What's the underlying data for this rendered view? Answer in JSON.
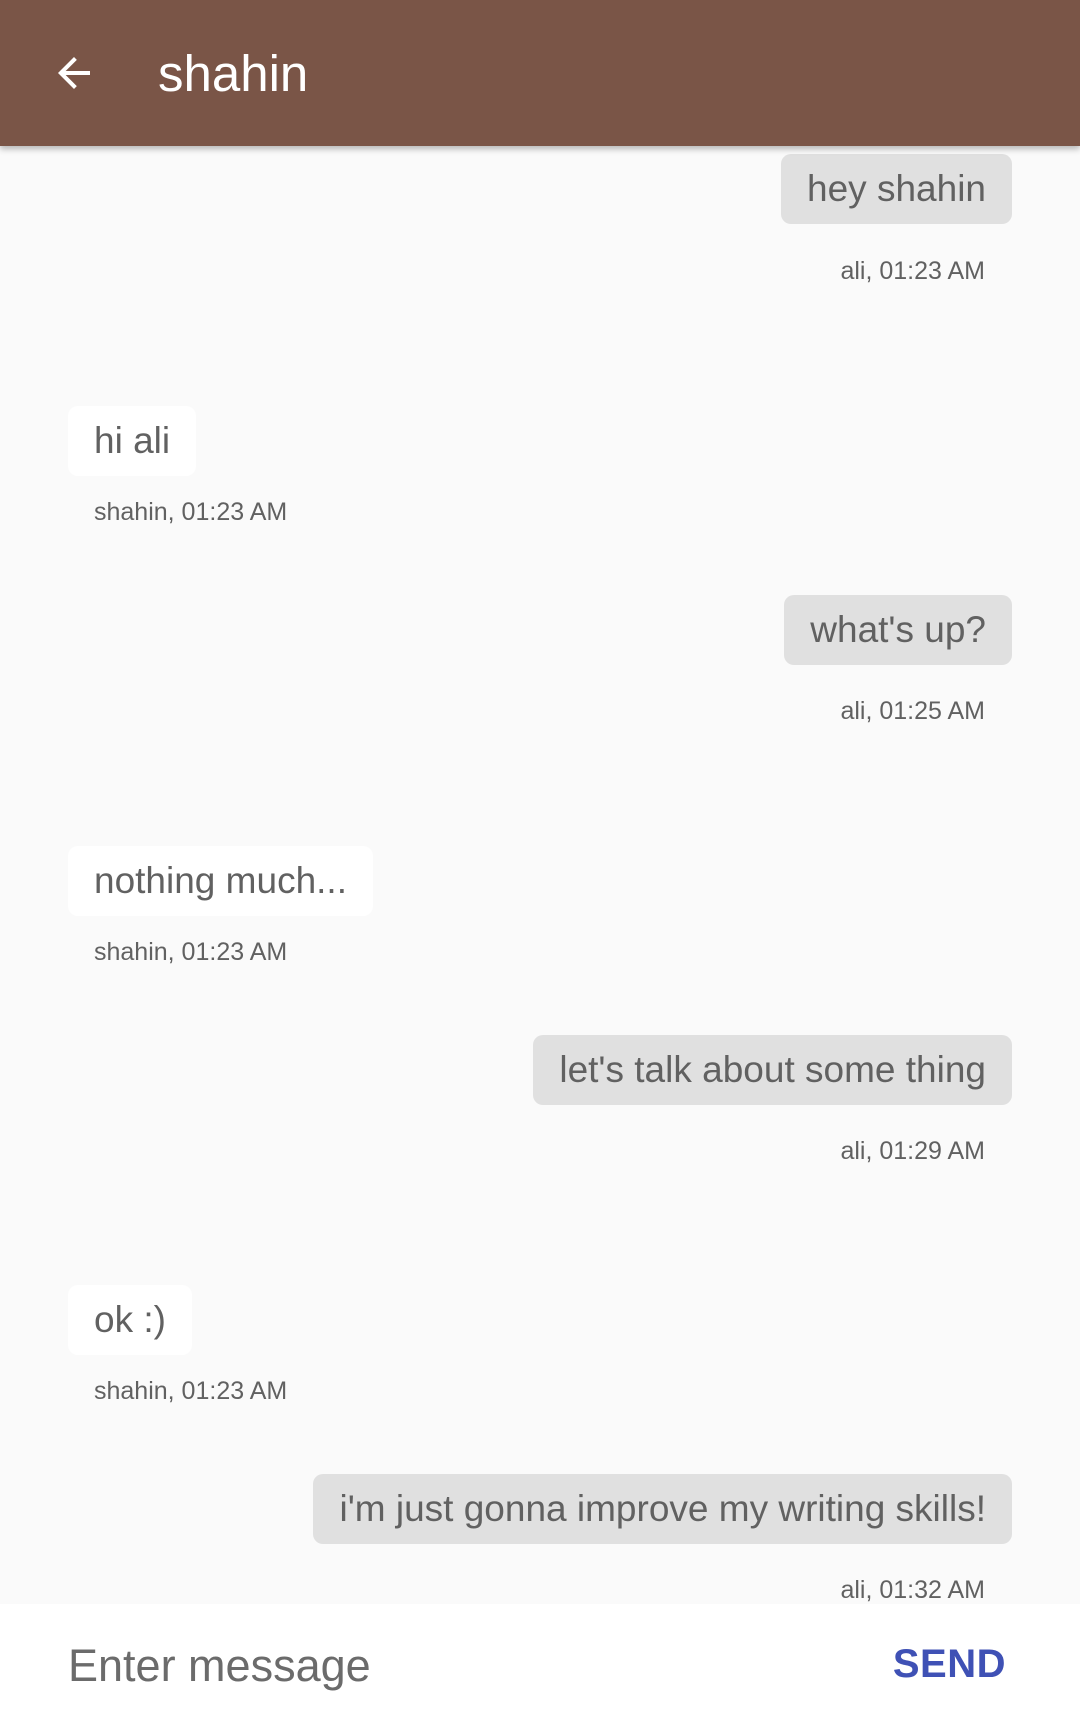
{
  "appbar": {
    "title": "shahin",
    "back_icon": "arrow-back-icon"
  },
  "messages": [
    {
      "direction": "sent",
      "text": "hey shahin",
      "meta": "ali, 01:23 AM"
    },
    {
      "direction": "received",
      "text": "hi ali",
      "meta": "shahin, 01:23 AM"
    },
    {
      "direction": "sent",
      "text": "what's up?",
      "meta": "ali, 01:25 AM"
    },
    {
      "direction": "received",
      "text": "nothing much...",
      "meta": "shahin, 01:23 AM"
    },
    {
      "direction": "sent",
      "text": "let's talk about some thing",
      "meta": "ali, 01:29 AM"
    },
    {
      "direction": "received",
      "text": "ok :)",
      "meta": "shahin, 01:23 AM"
    },
    {
      "direction": "sent",
      "text": "i'm just gonna improve my writing skills!",
      "meta": "ali, 01:32 AM"
    }
  ],
  "composer": {
    "placeholder": "Enter message",
    "value": "",
    "send_label": "SEND"
  },
  "colors": {
    "appbar": "#7a5547",
    "background": "#fafafa",
    "sent_bubble": "#e0e0e0",
    "received_bubble": "#ffffff",
    "send_accent": "#3f51b5"
  }
}
